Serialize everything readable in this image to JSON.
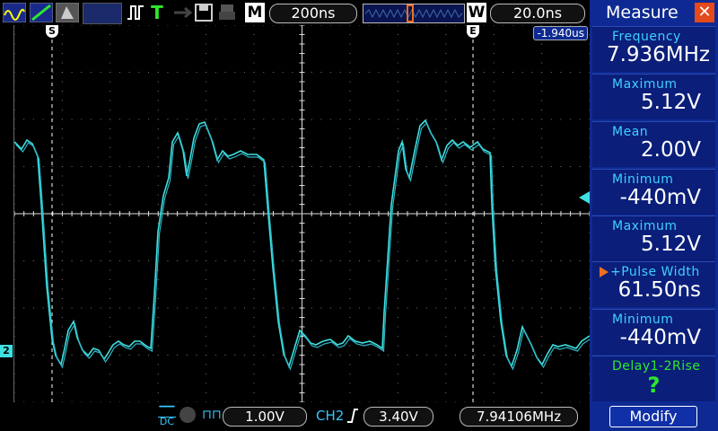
{
  "toolbar": {
    "timebase": "200ns",
    "m_label": "M",
    "w_label": "W",
    "window": "20.0ns"
  },
  "waveform": {
    "trigger_marker": "S",
    "end_marker": "E",
    "offset_readout": "-1.940us",
    "channel_marker": "2"
  },
  "measure": {
    "title": "Measure",
    "items": [
      {
        "label": "Frequency",
        "value": "7.936MHz"
      },
      {
        "label": "Maximum",
        "value": "5.12V"
      },
      {
        "label": "Mean",
        "value": "2.00V"
      },
      {
        "label": "Minimum",
        "value": "-440mV"
      },
      {
        "label": "Maximum",
        "value": "5.12V"
      },
      {
        "label": "+Pulse Width",
        "value": "61.50ns",
        "selected": true
      },
      {
        "label": "Minimum",
        "value": "-440mV"
      },
      {
        "label": "Delay1-2Rise",
        "value": "?"
      }
    ],
    "modify_label": "Modify"
  },
  "status": {
    "coupling": "DC",
    "volts_div": "1.00V",
    "trig_source": "CH2",
    "trig_level": "3.40V",
    "freq_counter": "7.94106MHz"
  },
  "colors": {
    "trace": "#3fe0e0",
    "panel": "#0e2a92",
    "accent": "#f07020"
  }
}
